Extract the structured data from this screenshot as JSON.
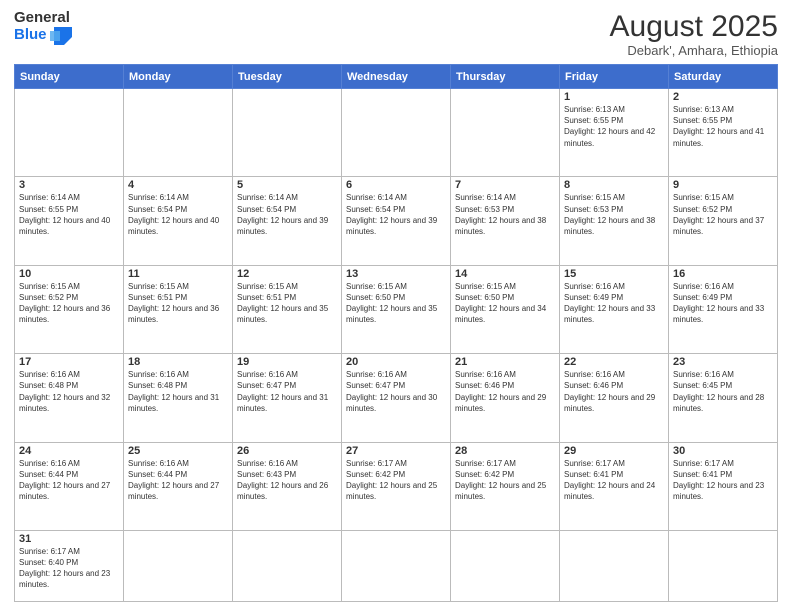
{
  "logo": {
    "line1": "General",
    "line2": "Blue"
  },
  "header": {
    "title": "August 2025",
    "subtitle": "Debark', Amhara, Ethiopia"
  },
  "days_of_week": [
    "Sunday",
    "Monday",
    "Tuesday",
    "Wednesday",
    "Thursday",
    "Friday",
    "Saturday"
  ],
  "weeks": [
    [
      {
        "day": "",
        "empty": true
      },
      {
        "day": "",
        "empty": true
      },
      {
        "day": "",
        "empty": true
      },
      {
        "day": "",
        "empty": true
      },
      {
        "day": "",
        "empty": true
      },
      {
        "day": "1",
        "sunrise": "6:13 AM",
        "sunset": "6:55 PM",
        "daylight": "12 hours and 42 minutes."
      },
      {
        "day": "2",
        "sunrise": "6:13 AM",
        "sunset": "6:55 PM",
        "daylight": "12 hours and 41 minutes."
      }
    ],
    [
      {
        "day": "3",
        "sunrise": "6:14 AM",
        "sunset": "6:55 PM",
        "daylight": "12 hours and 40 minutes."
      },
      {
        "day": "4",
        "sunrise": "6:14 AM",
        "sunset": "6:54 PM",
        "daylight": "12 hours and 40 minutes."
      },
      {
        "day": "5",
        "sunrise": "6:14 AM",
        "sunset": "6:54 PM",
        "daylight": "12 hours and 39 minutes."
      },
      {
        "day": "6",
        "sunrise": "6:14 AM",
        "sunset": "6:54 PM",
        "daylight": "12 hours and 39 minutes."
      },
      {
        "day": "7",
        "sunrise": "6:14 AM",
        "sunset": "6:53 PM",
        "daylight": "12 hours and 38 minutes."
      },
      {
        "day": "8",
        "sunrise": "6:15 AM",
        "sunset": "6:53 PM",
        "daylight": "12 hours and 38 minutes."
      },
      {
        "day": "9",
        "sunrise": "6:15 AM",
        "sunset": "6:52 PM",
        "daylight": "12 hours and 37 minutes."
      }
    ],
    [
      {
        "day": "10",
        "sunrise": "6:15 AM",
        "sunset": "6:52 PM",
        "daylight": "12 hours and 36 minutes."
      },
      {
        "day": "11",
        "sunrise": "6:15 AM",
        "sunset": "6:51 PM",
        "daylight": "12 hours and 36 minutes."
      },
      {
        "day": "12",
        "sunrise": "6:15 AM",
        "sunset": "6:51 PM",
        "daylight": "12 hours and 35 minutes."
      },
      {
        "day": "13",
        "sunrise": "6:15 AM",
        "sunset": "6:50 PM",
        "daylight": "12 hours and 35 minutes."
      },
      {
        "day": "14",
        "sunrise": "6:15 AM",
        "sunset": "6:50 PM",
        "daylight": "12 hours and 34 minutes."
      },
      {
        "day": "15",
        "sunrise": "6:16 AM",
        "sunset": "6:49 PM",
        "daylight": "12 hours and 33 minutes."
      },
      {
        "day": "16",
        "sunrise": "6:16 AM",
        "sunset": "6:49 PM",
        "daylight": "12 hours and 33 minutes."
      }
    ],
    [
      {
        "day": "17",
        "sunrise": "6:16 AM",
        "sunset": "6:48 PM",
        "daylight": "12 hours and 32 minutes."
      },
      {
        "day": "18",
        "sunrise": "6:16 AM",
        "sunset": "6:48 PM",
        "daylight": "12 hours and 31 minutes."
      },
      {
        "day": "19",
        "sunrise": "6:16 AM",
        "sunset": "6:47 PM",
        "daylight": "12 hours and 31 minutes."
      },
      {
        "day": "20",
        "sunrise": "6:16 AM",
        "sunset": "6:47 PM",
        "daylight": "12 hours and 30 minutes."
      },
      {
        "day": "21",
        "sunrise": "6:16 AM",
        "sunset": "6:46 PM",
        "daylight": "12 hours and 29 minutes."
      },
      {
        "day": "22",
        "sunrise": "6:16 AM",
        "sunset": "6:46 PM",
        "daylight": "12 hours and 29 minutes."
      },
      {
        "day": "23",
        "sunrise": "6:16 AM",
        "sunset": "6:45 PM",
        "daylight": "12 hours and 28 minutes."
      }
    ],
    [
      {
        "day": "24",
        "sunrise": "6:16 AM",
        "sunset": "6:44 PM",
        "daylight": "12 hours and 27 minutes."
      },
      {
        "day": "25",
        "sunrise": "6:16 AM",
        "sunset": "6:44 PM",
        "daylight": "12 hours and 27 minutes."
      },
      {
        "day": "26",
        "sunrise": "6:16 AM",
        "sunset": "6:43 PM",
        "daylight": "12 hours and 26 minutes."
      },
      {
        "day": "27",
        "sunrise": "6:17 AM",
        "sunset": "6:42 PM",
        "daylight": "12 hours and 25 minutes."
      },
      {
        "day": "28",
        "sunrise": "6:17 AM",
        "sunset": "6:42 PM",
        "daylight": "12 hours and 25 minutes."
      },
      {
        "day": "29",
        "sunrise": "6:17 AM",
        "sunset": "6:41 PM",
        "daylight": "12 hours and 24 minutes."
      },
      {
        "day": "30",
        "sunrise": "6:17 AM",
        "sunset": "6:41 PM",
        "daylight": "12 hours and 23 minutes."
      }
    ],
    [
      {
        "day": "31",
        "sunrise": "6:17 AM",
        "sunset": "6:40 PM",
        "daylight": "12 hours and 23 minutes."
      },
      {
        "day": "",
        "empty": true
      },
      {
        "day": "",
        "empty": true
      },
      {
        "day": "",
        "empty": true
      },
      {
        "day": "",
        "empty": true
      },
      {
        "day": "",
        "empty": true
      },
      {
        "day": "",
        "empty": true
      }
    ]
  ]
}
